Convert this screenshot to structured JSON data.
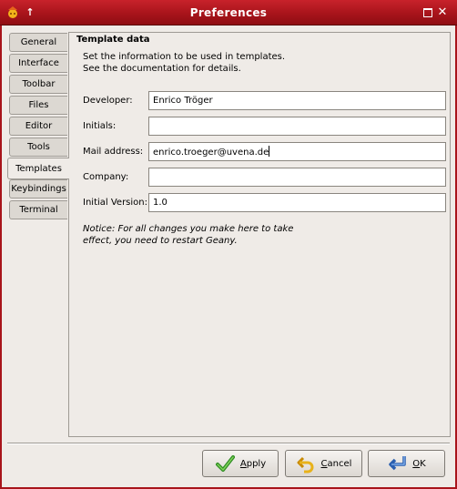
{
  "window": {
    "title": "Preferences"
  },
  "tabs": [
    "General",
    "Interface",
    "Toolbar",
    "Files",
    "Editor",
    "Tools",
    "Templates",
    "Keybindings",
    "Terminal"
  ],
  "active_tab": "Templates",
  "panel": {
    "section_title": "Template data",
    "description": [
      "Set the information to be used in templates.",
      "See the documentation for details."
    ],
    "fields": [
      {
        "label": "Developer:",
        "value": "Enrico Tröger"
      },
      {
        "label": "Initials:",
        "value": ""
      },
      {
        "label": "Mail address:",
        "value": "enrico.troeger@uvena.de"
      },
      {
        "label": "Company:",
        "value": ""
      },
      {
        "label": "Initial Version:",
        "value": "1.0"
      }
    ],
    "notice": [
      "Notice: For all changes you make here to take",
      "effect, you need to restart Geany."
    ]
  },
  "buttons": {
    "apply": {
      "pre": "",
      "mnemonic": "A",
      "post": "pply"
    },
    "cancel": {
      "pre": "",
      "mnemonic": "C",
      "post": "ancel"
    },
    "ok": {
      "pre": "",
      "mnemonic": "O",
      "post": "K"
    }
  },
  "colors": {
    "titlebar": "#a8141b",
    "background": "#efebe7"
  }
}
